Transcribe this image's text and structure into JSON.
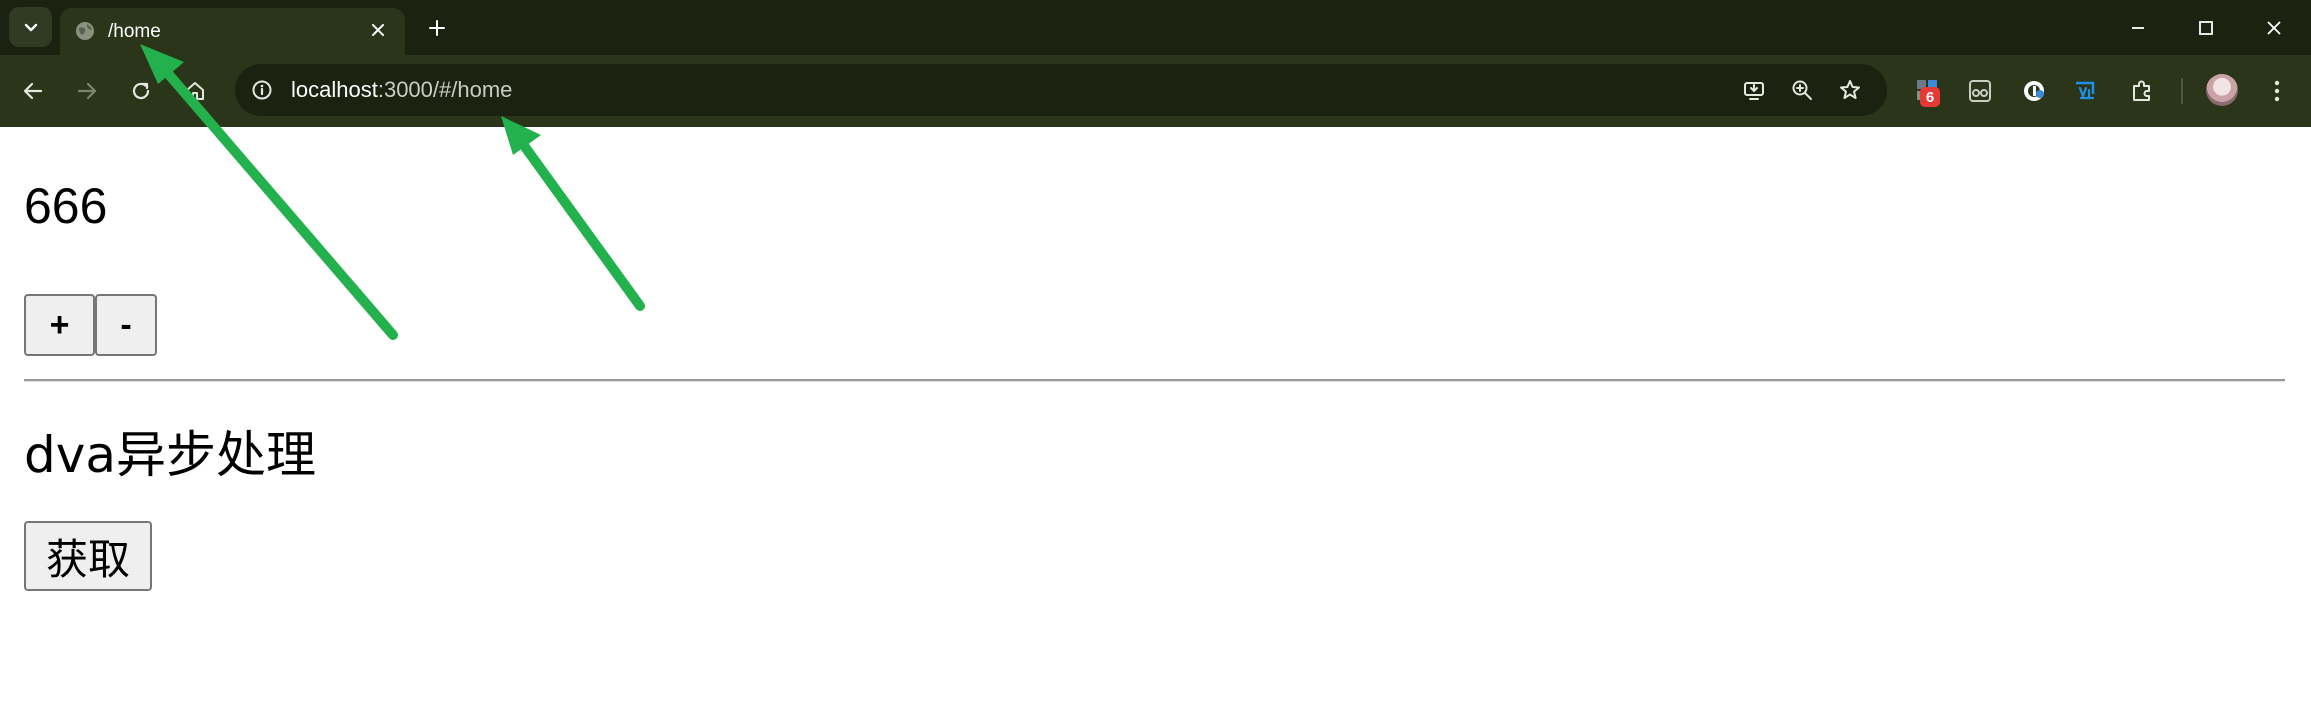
{
  "browser": {
    "tab": {
      "title": "/home"
    },
    "address_bar": {
      "host": "localhost",
      "path": ":3000/#/home"
    },
    "extension_badge": "6",
    "icons": [
      "tab-search-icon",
      "globe-icon",
      "close-icon",
      "plus-icon",
      "minimize-icon",
      "maximize-icon",
      "close-window-icon",
      "back-icon",
      "forward-icon",
      "reload-icon",
      "home-icon",
      "info-icon",
      "install-app-icon",
      "zoom-icon",
      "star-icon",
      "puzzle-icon",
      "menu-icon"
    ]
  },
  "page": {
    "counter_value": "666",
    "increment_label": "+",
    "decrement_label": "-",
    "section_title": "dva异步处理",
    "fetch_label": "获取"
  },
  "colors": {
    "annotation_arrow": "#22b14c",
    "titlebar": "#1b2210",
    "toolbar": "#2a3519"
  }
}
